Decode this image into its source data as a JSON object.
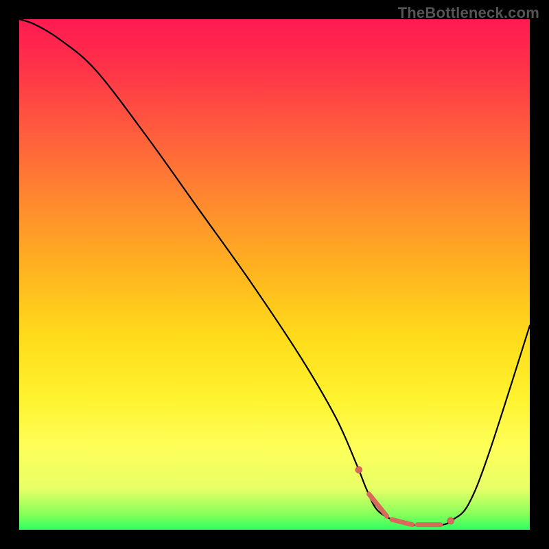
{
  "watermark": "TheBottleneck.com",
  "colors": {
    "curve": "#000000",
    "marker_fill": "#d86a5c",
    "marker_stroke": "#b0453a",
    "gradient_top": "#ff1a52",
    "gradient_bottom": "#2eff63"
  },
  "chart_data": {
    "type": "line",
    "title": "",
    "xlabel": "",
    "ylabel": "",
    "xlim": [
      0,
      100
    ],
    "ylim": [
      0,
      100
    ],
    "grid": false,
    "x": [
      0,
      3,
      8,
      15,
      25,
      35,
      45,
      55,
      62,
      66,
      68,
      70,
      73,
      76,
      80,
      83,
      85,
      88,
      92,
      100
    ],
    "values": [
      100,
      99,
      96,
      90,
      77,
      63,
      49,
      34,
      22,
      13,
      8,
      4,
      2,
      1,
      1,
      1,
      2,
      5,
      15,
      40
    ],
    "markers": {
      "dots_x": [
        66.5,
        84.5
      ],
      "dashes_x": [
        [
          68.5,
          72.0
        ],
        [
          73.0,
          77.0
        ],
        [
          78.0,
          82.5
        ]
      ]
    }
  }
}
